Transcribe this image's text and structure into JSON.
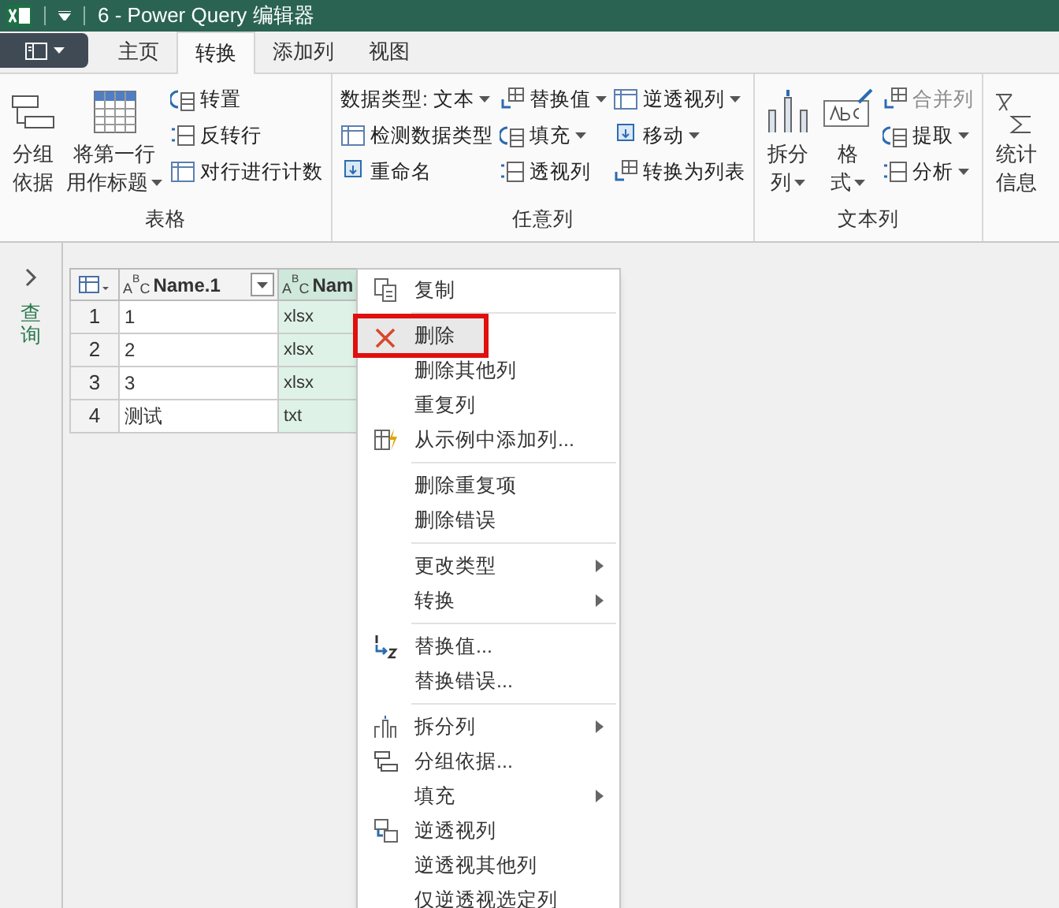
{
  "window": {
    "title": "6 - Power Query 编辑器"
  },
  "tabs": [
    {
      "label": "主页",
      "selected": false
    },
    {
      "label": "转换",
      "selected": true
    },
    {
      "label": "添加列",
      "selected": false
    },
    {
      "label": "视图",
      "selected": false
    }
  ],
  "ribbon": {
    "groups": [
      {
        "label": "表格",
        "columns": [
          {
            "kind": "large",
            "lines": [
              "分组",
              "依据"
            ],
            "dropdown": false
          },
          {
            "kind": "large",
            "lines": [
              "将第一行",
              "用作标题"
            ],
            "dropdown": true
          },
          {
            "kind": "stack",
            "buttons": [
              {
                "label": "转置",
                "dropdown": false,
                "disabled": false
              },
              {
                "label": "反转行",
                "dropdown": false,
                "disabled": false
              },
              {
                "label": "对行进行计数",
                "dropdown": false,
                "disabled": false
              }
            ]
          }
        ]
      },
      {
        "label": "任意列",
        "columns": [
          {
            "kind": "stack",
            "buttons": [
              {
                "label": "数据类型: 文本",
                "dropdown": true,
                "disabled": false
              },
              {
                "label": "检测数据类型",
                "dropdown": false,
                "disabled": false
              },
              {
                "label": "重命名",
                "dropdown": false,
                "disabled": false
              }
            ]
          },
          {
            "kind": "stack",
            "buttons": [
              {
                "label": "替换值",
                "dropdown": true,
                "disabled": false
              },
              {
                "label": "填充",
                "dropdown": true,
                "disabled": false
              },
              {
                "label": "透视列",
                "dropdown": false,
                "disabled": false
              }
            ]
          },
          {
            "kind": "stack",
            "buttons": [
              {
                "label": "逆透视列",
                "dropdown": true,
                "disabled": false
              },
              {
                "label": "移动",
                "dropdown": true,
                "disabled": false
              },
              {
                "label": "转换为列表",
                "dropdown": false,
                "disabled": false
              }
            ]
          }
        ]
      },
      {
        "label": "文本列",
        "columns": [
          {
            "kind": "large",
            "lines": [
              "拆分",
              "列"
            ],
            "dropdown": true
          },
          {
            "kind": "large",
            "lines": [
              "格",
              "式"
            ],
            "dropdown": true
          },
          {
            "kind": "stack",
            "buttons": [
              {
                "label": "合并列",
                "dropdown": false,
                "disabled": true
              },
              {
                "label": "提取",
                "dropdown": true,
                "disabled": false
              },
              {
                "label": "分析",
                "dropdown": true,
                "disabled": false
              }
            ]
          }
        ]
      },
      {
        "columns": [
          {
            "kind": "large",
            "lines": [
              "统计",
              "信息"
            ],
            "dropdown": false
          }
        ]
      }
    ]
  },
  "queries_pane": {
    "label": "查询"
  },
  "table": {
    "columns": [
      {
        "type_letters": [
          "A",
          "B",
          "C"
        ],
        "label": "Name.1",
        "selected": false
      },
      {
        "type_letters": [
          "A",
          "B",
          "C"
        ],
        "label": "Nam",
        "selected": true
      }
    ],
    "rows": [
      {
        "number": "1",
        "cells": [
          "1",
          "xlsx"
        ]
      },
      {
        "number": "2",
        "cells": [
          "2",
          "xlsx"
        ]
      },
      {
        "number": "3",
        "cells": [
          "3",
          "xlsx"
        ]
      },
      {
        "number": "4",
        "cells": [
          "测试",
          "txt"
        ]
      }
    ]
  },
  "context_menu": {
    "items": [
      {
        "kind": "item",
        "label": "复制",
        "selected": false,
        "submenu": false
      },
      {
        "kind": "separator"
      },
      {
        "kind": "item",
        "label": "删除",
        "selected": true,
        "submenu": false
      },
      {
        "kind": "item",
        "label": "删除其他列",
        "selected": false,
        "submenu": false
      },
      {
        "kind": "item",
        "label": "重复列",
        "selected": false,
        "submenu": false
      },
      {
        "kind": "item",
        "label": "从示例中添加列...",
        "selected": false,
        "submenu": false
      },
      {
        "kind": "separator"
      },
      {
        "kind": "item",
        "label": "删除重复项",
        "selected": false,
        "submenu": false
      },
      {
        "kind": "item",
        "label": "删除错误",
        "selected": false,
        "submenu": false
      },
      {
        "kind": "separator"
      },
      {
        "kind": "item",
        "label": "更改类型",
        "selected": false,
        "submenu": true
      },
      {
        "kind": "item",
        "label": "转换",
        "selected": false,
        "submenu": true
      },
      {
        "kind": "separator"
      },
      {
        "kind": "item",
        "label": "替换值...",
        "selected": false,
        "submenu": false
      },
      {
        "kind": "item",
        "label": "替换错误...",
        "selected": false,
        "submenu": false
      },
      {
        "kind": "separator"
      },
      {
        "kind": "item",
        "label": "拆分列",
        "selected": false,
        "submenu": true
      },
      {
        "kind": "item",
        "label": "分组依据...",
        "selected": false,
        "submenu": false
      },
      {
        "kind": "item",
        "label": "填充",
        "selected": false,
        "submenu": true
      },
      {
        "kind": "item",
        "label": "逆透视列",
        "selected": false,
        "submenu": false
      },
      {
        "kind": "item",
        "label": "逆透视其他列",
        "selected": false,
        "submenu": false
      },
      {
        "kind": "item",
        "label": "仅逆透视选定列",
        "selected": false,
        "submenu": false
      }
    ]
  }
}
